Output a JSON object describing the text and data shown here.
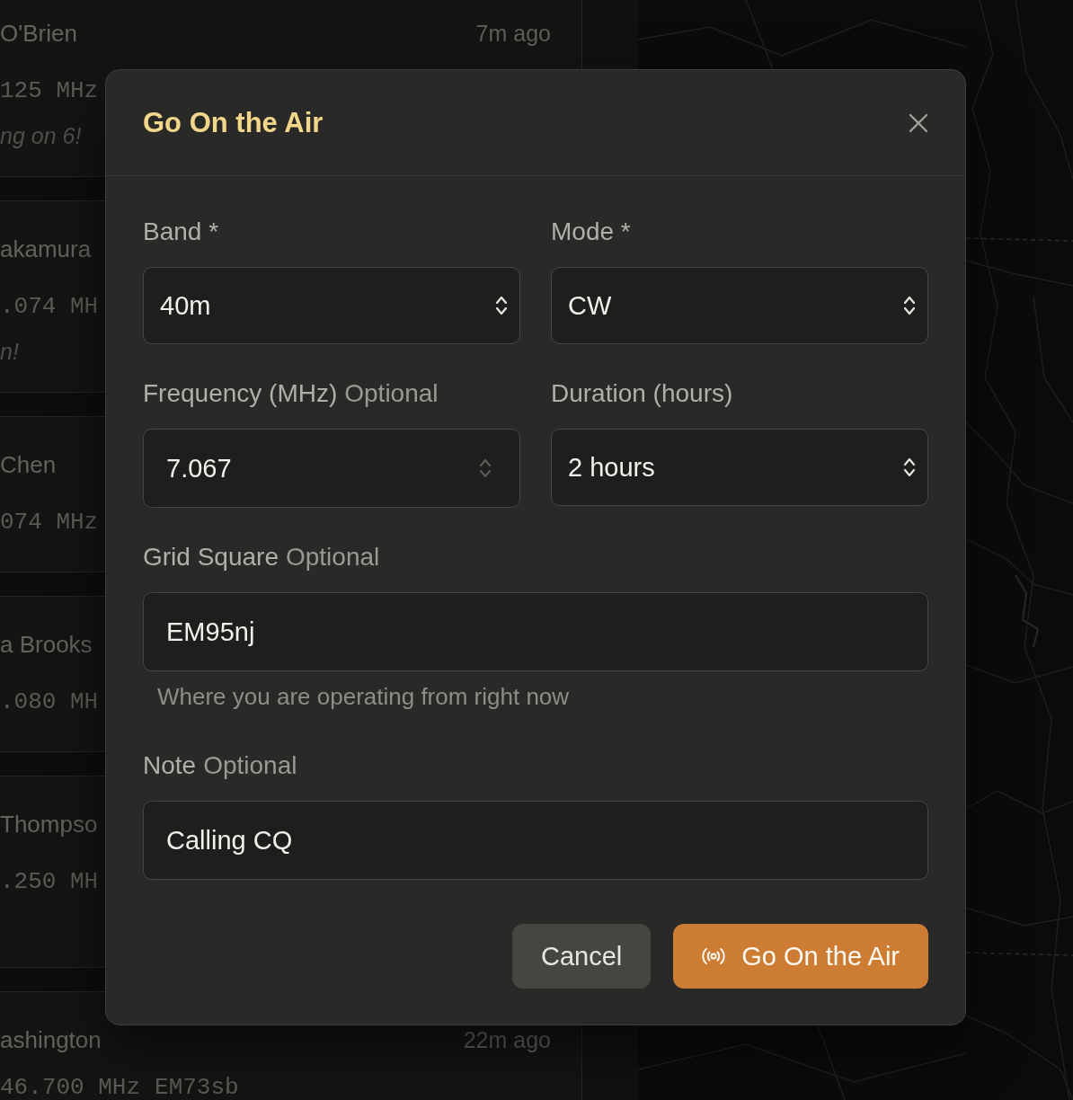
{
  "spot_list": {
    "spots": [
      {
        "name": "O'Brien",
        "time": "7m ago",
        "frequency": "125 MHz",
        "note": "ng on 6!"
      },
      {
        "name": "akamura",
        "frequency": ".074 MH",
        "note": "n!"
      },
      {
        "name": "Chen",
        "frequency": "074 MHz"
      },
      {
        "name": "a Brooks",
        "frequency": ".080 MH"
      },
      {
        "name": "Thompso",
        "frequency": ".250 MH"
      },
      {
        "name": "ashington",
        "time": "22m ago",
        "frequency": "46.700 MHz",
        "grid": "EM73sb"
      }
    ]
  },
  "dialog": {
    "title": "Go On the Air",
    "rows": [
      [
        {
          "kind": "select",
          "label": "Band *",
          "value": "40m"
        },
        {
          "kind": "select",
          "label": "Mode *",
          "value": "CW"
        }
      ],
      [
        {
          "kind": "number",
          "label": "Frequency (MHz)",
          "hint": "Optional",
          "value": "7.067"
        },
        {
          "kind": "select",
          "label": "Duration (hours)",
          "value": "2 hours"
        }
      ],
      [
        {
          "kind": "text",
          "label": "Grid Square",
          "hint": "Optional",
          "value": "EM95nj",
          "help": "Where you are operating from right now"
        }
      ],
      [
        {
          "kind": "text",
          "label": "Note",
          "hint": "Optional",
          "value": "Calling CQ"
        }
      ]
    ],
    "buttons": [
      {
        "kind": "secondary",
        "label": "Cancel"
      },
      {
        "kind": "primary",
        "label": "Go On the Air"
      }
    ]
  }
}
